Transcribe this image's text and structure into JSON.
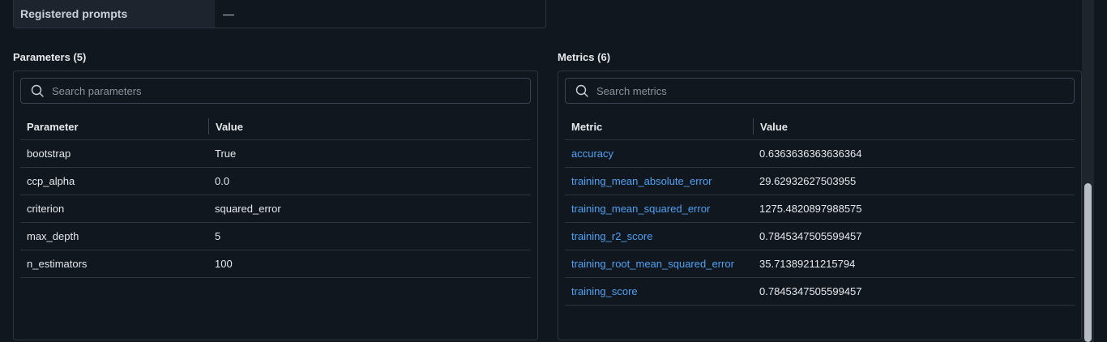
{
  "registered_prompts": {
    "label": "Registered prompts",
    "value": "—"
  },
  "parameters": {
    "title": "Parameters (5)",
    "search_placeholder": "Search parameters",
    "columns": [
      "Parameter",
      "Value"
    ],
    "rows": [
      {
        "name": "bootstrap",
        "value": "True"
      },
      {
        "name": "ccp_alpha",
        "value": "0.0"
      },
      {
        "name": "criterion",
        "value": "squared_error"
      },
      {
        "name": "max_depth",
        "value": "5"
      },
      {
        "name": "n_estimators",
        "value": "100"
      }
    ]
  },
  "metrics": {
    "title": "Metrics (6)",
    "search_placeholder": "Search metrics",
    "columns": [
      "Metric",
      "Value"
    ],
    "rows": [
      {
        "name": "accuracy",
        "value": "0.6363636363636364"
      },
      {
        "name": "training_mean_absolute_error",
        "value": "29.62932627503955"
      },
      {
        "name": "training_mean_squared_error",
        "value": "1275.4820897988575"
      },
      {
        "name": "training_r2_score",
        "value": "0.7845347505599457"
      },
      {
        "name": "training_root_mean_squared_error",
        "value": "35.71389211215794"
      },
      {
        "name": "training_score",
        "value": "0.7845347505599457"
      }
    ]
  },
  "icons": {
    "search": "search-icon"
  },
  "colors": {
    "link": "#4ea1f3",
    "background": "#11171e",
    "border": "#2c3440"
  }
}
